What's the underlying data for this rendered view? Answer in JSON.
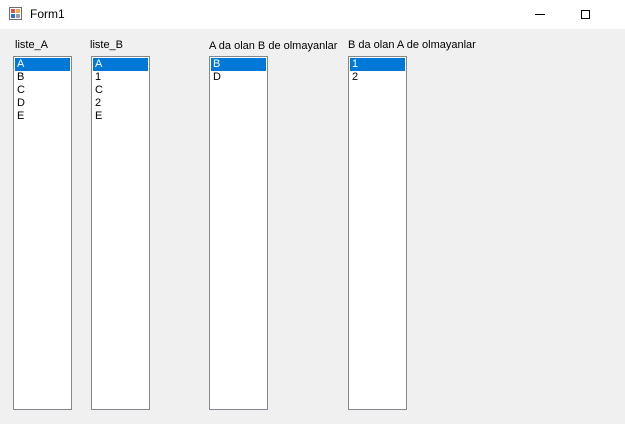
{
  "window": {
    "title": "Form1",
    "minimize_glyph": "minimize-icon",
    "maximize_glyph": "maximize-icon"
  },
  "labels": {
    "liste_a": "liste_A",
    "liste_b": "liste_B",
    "a_not_b": "A da olan B de olmayanlar",
    "b_not_a": "B da olan A de olmayanlar"
  },
  "lists": {
    "liste_a": {
      "items": [
        "A",
        "B",
        "C",
        "D",
        "E"
      ],
      "selected_index": 0
    },
    "liste_b": {
      "items": [
        "A",
        "1",
        "C",
        "2",
        "E"
      ],
      "selected_index": 0
    },
    "a_not_b": {
      "items": [
        "B",
        "D"
      ],
      "selected_index": 0
    },
    "b_not_a": {
      "items": [
        "1",
        "2"
      ],
      "selected_index": 0
    }
  },
  "colors": {
    "selection": "#0078d7",
    "selection_text": "#ffffff",
    "form_background": "#f0f0f0"
  }
}
